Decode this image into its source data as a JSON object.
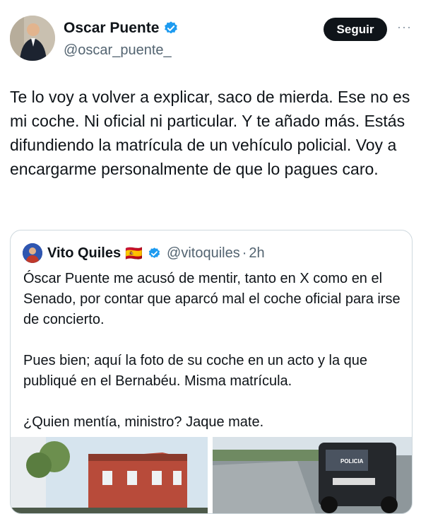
{
  "author": {
    "name": "Oscar Puente",
    "handle": "@oscar_puente_"
  },
  "follow_label": "Seguir",
  "more_label": "···",
  "tweet_text": "Te lo voy a volver a explicar, saco de mierda. Ese no es mi coche. Ni oficial ni particular. Y te añado más. Estás difundiendo la matrícula de un vehículo policial. Voy a encargarme personalmente de que lo pagues caro.",
  "quote": {
    "name": "Vito Quiles",
    "flag": "🇪🇸",
    "handle": "@vitoquiles",
    "separator": "·",
    "time": "2h",
    "paragraphs": [
      "Óscar Puente me acusó de mentir, tanto en X como en el Senado, por contar que aparcó mal el coche oficial para irse de concierto.",
      "Pues bien; aquí la foto de su coche en un acto y la que publiqué en el Bernabéu. Misma matrícula.",
      "¿Quien mentía, ministro? Jaque mate."
    ],
    "image_caption": "POLICIA"
  },
  "colors": {
    "verified": "#1d9bf0",
    "text": "#0f1419",
    "muted": "#536471",
    "border": "#cfd9de"
  },
  "icons": {
    "verified": "verified-badge-icon",
    "avatar": "avatar",
    "more": "more-icon"
  }
}
